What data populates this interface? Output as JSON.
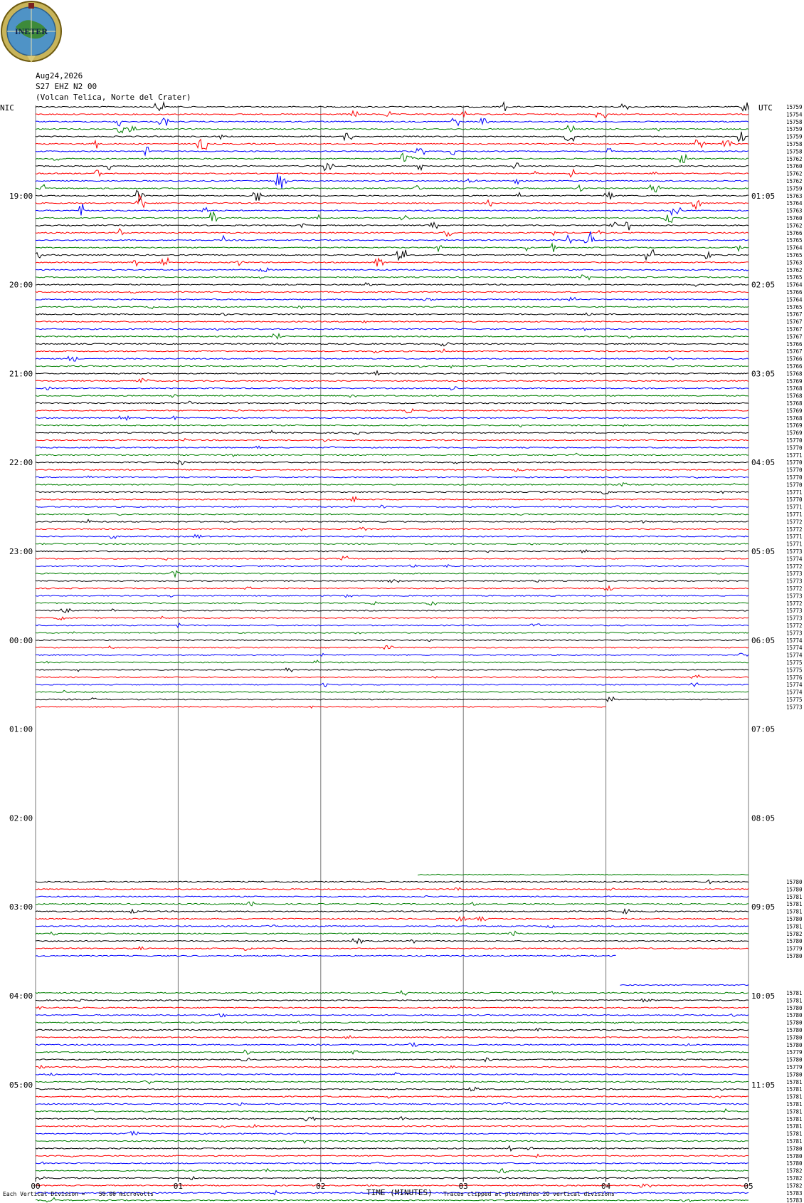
{
  "header": {
    "date": "Aug24,2026",
    "station": "S27 EHZ N2 00",
    "location": "(Volcan Telica, Norte del Crater)",
    "logo_text": "INETER"
  },
  "chart_data": {
    "type": "line",
    "title": "",
    "left_axis_title": "NIC",
    "right_axis_title": "UTC",
    "xlabel": "TIME (MINUTES)",
    "x_ticks": [
      "00",
      "01",
      "02",
      "03",
      "04",
      "05"
    ],
    "xlim": [
      0,
      5
    ],
    "left_hour_labels": [
      "19:00",
      "20:00",
      "21:00",
      "22:00",
      "23:00",
      "00:00",
      "01:00",
      "02:00",
      "03:00",
      "04:00",
      "05:00"
    ],
    "right_hour_labels": [
      "01:05",
      "02:05",
      "03:05",
      "04:05",
      "05:05",
      "06:05",
      "07:05",
      "08:05",
      "09:05",
      "10:05",
      "11:05"
    ],
    "scale_note": "Each Vertical Division =    50.00 microvolts",
    "clip_note": "Traces clipped at plus/minus 20 vertical divisions",
    "trace_colors": [
      "#000000",
      "#ff0000",
      "#0000ff",
      "#007f00"
    ],
    "block1_right_values": [
      "15759",
      "15754",
      "15758",
      "15759",
      "15759",
      "15758",
      "15758",
      "15762",
      "15760",
      "15762",
      "15762",
      "15759",
      "15763",
      "15764",
      "15763",
      "15760",
      "15762",
      "15766",
      "15765",
      "15764",
      "15765",
      "15763",
      "15762",
      "15765",
      "15764",
      "15766",
      "15764",
      "15765",
      "15767",
      "15767",
      "15767",
      "15767",
      "15766",
      "15767",
      "15766",
      "15766",
      "15768",
      "15769",
      "15768",
      "15768",
      "15768",
      "15769",
      "15768",
      "15769",
      "15769",
      "15770",
      "15770",
      "15771",
      "15770",
      "15770",
      "15770",
      "15770",
      "15771",
      "15770",
      "15771",
      "15771",
      "15772",
      "15772",
      "15771",
      "15771",
      "15773",
      "15774",
      "15772",
      "15773",
      "15773",
      "15772",
      "15773",
      "15772",
      "15773",
      "15773",
      "15772",
      "15773",
      "15774",
      "15774",
      "15774",
      "15775",
      "15775",
      "15776",
      "15774",
      "15774",
      "15775",
      "15773"
    ],
    "block2_right_values": [
      "15780",
      "15780",
      "15781",
      "15781",
      "15781",
      "15780",
      "15781",
      "15782",
      "15780",
      "15779",
      "15780"
    ],
    "block3_right_values": [
      "15781",
      "15781",
      "15780",
      "15780",
      "15780",
      "15780",
      "15780",
      "15780",
      "15779",
      "15780",
      "15779",
      "15780",
      "15781",
      "15781",
      "15781",
      "15781",
      "15781",
      "15781",
      "15781",
      "15781",
      "15781",
      "15780",
      "15780",
      "15780",
      "15782",
      "15782",
      "15782",
      "15783",
      "15783"
    ]
  }
}
